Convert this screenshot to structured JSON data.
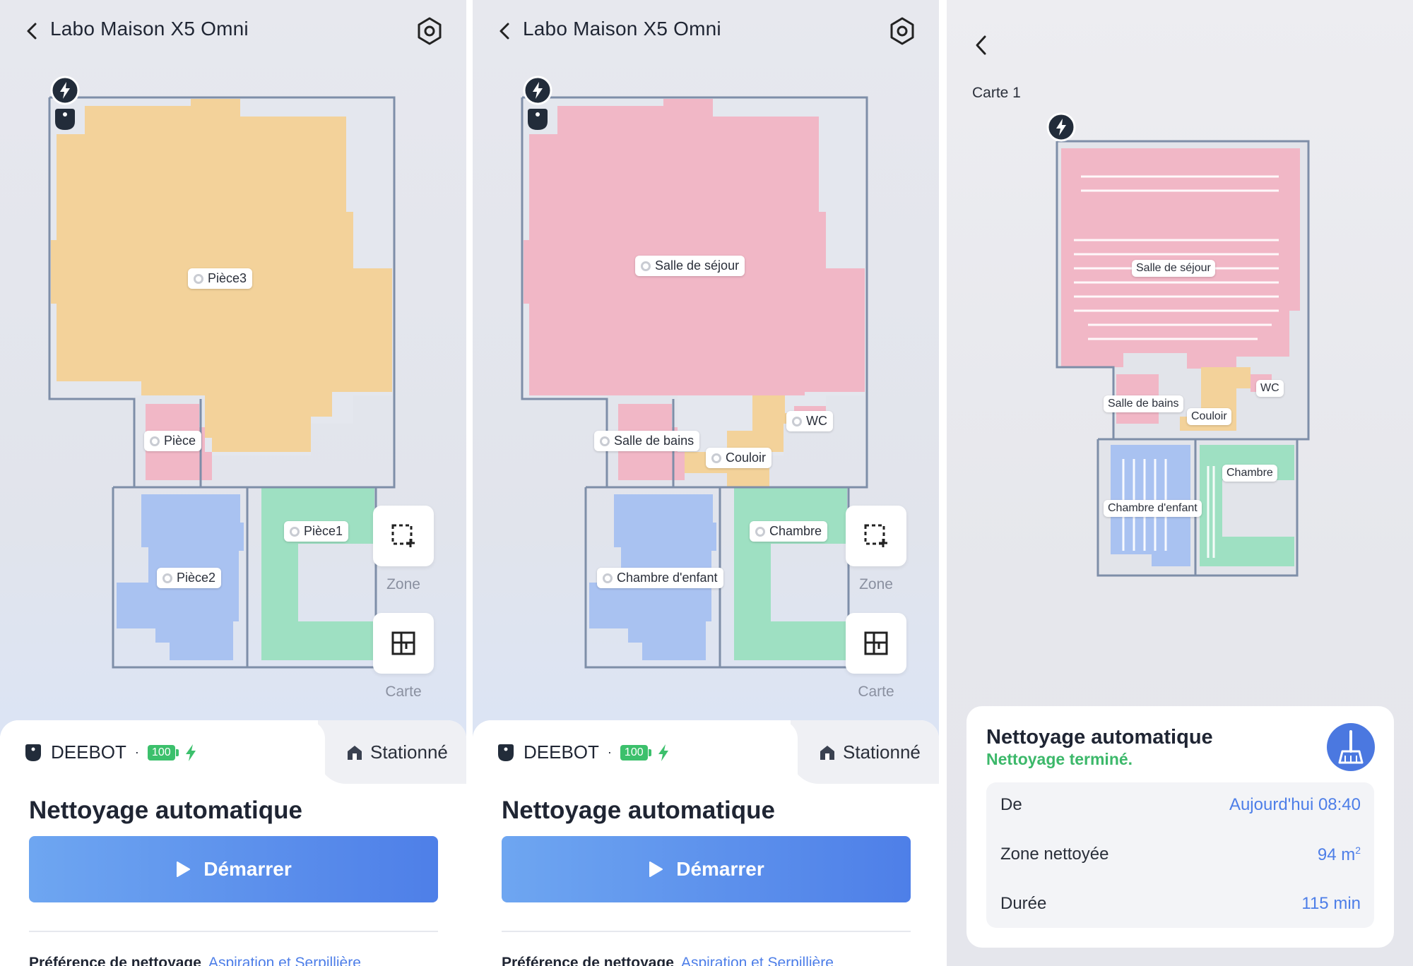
{
  "colors": {
    "accent": "#4d7ee8",
    "success": "#3cb86a",
    "room_yellow": "#f3d29a",
    "room_pink": "#f1b7c6",
    "room_blue": "#a9c2f1",
    "room_green": "#9ee0c2",
    "wall": "#7e8ea8"
  },
  "panel1": {
    "title": "Labo Maison X5 Omni",
    "rooms": [
      "Pièce3",
      "Pièce",
      "Pièce1",
      "Pièce2"
    ],
    "tools": {
      "zone": "Zone",
      "carte": "Carte"
    },
    "device": "DEEBOT",
    "battery": "100",
    "station": "Stationné",
    "mode_title": "Nettoyage automatique",
    "start_label": "Démarrer",
    "pref_label": "Préférence de nettoyage",
    "pref_value": "Aspiration et Serpillière"
  },
  "panel2": {
    "title": "Labo Maison X5 Omni",
    "rooms": [
      "Salle de séjour",
      "WC",
      "Salle de bains",
      "Couloir",
      "Chambre",
      "Chambre d'enfant"
    ],
    "tools": {
      "zone": "Zone",
      "carte": "Carte"
    },
    "device": "DEEBOT",
    "battery": "100",
    "station": "Stationné",
    "mode_title": "Nettoyage automatique",
    "start_label": "Démarrer",
    "pref_label": "Préférence de nettoyage",
    "pref_value": "Aspiration et Serpillière"
  },
  "panel3": {
    "map_name": "Carte 1",
    "rooms": [
      "Salle de séjour",
      "WC",
      "Salle de bains",
      "Couloir",
      "Chambre",
      "Chambre d'enfant"
    ],
    "summary": {
      "title": "Nettoyage automatique",
      "status": "Nettoyage terminé.",
      "rows": [
        {
          "key": "De",
          "value": "Aujourd'hui 08:40"
        },
        {
          "key": "Zone nettoyée",
          "value": "94 m",
          "sup": "2"
        },
        {
          "key": "Durée",
          "value": "115 min"
        }
      ]
    }
  }
}
